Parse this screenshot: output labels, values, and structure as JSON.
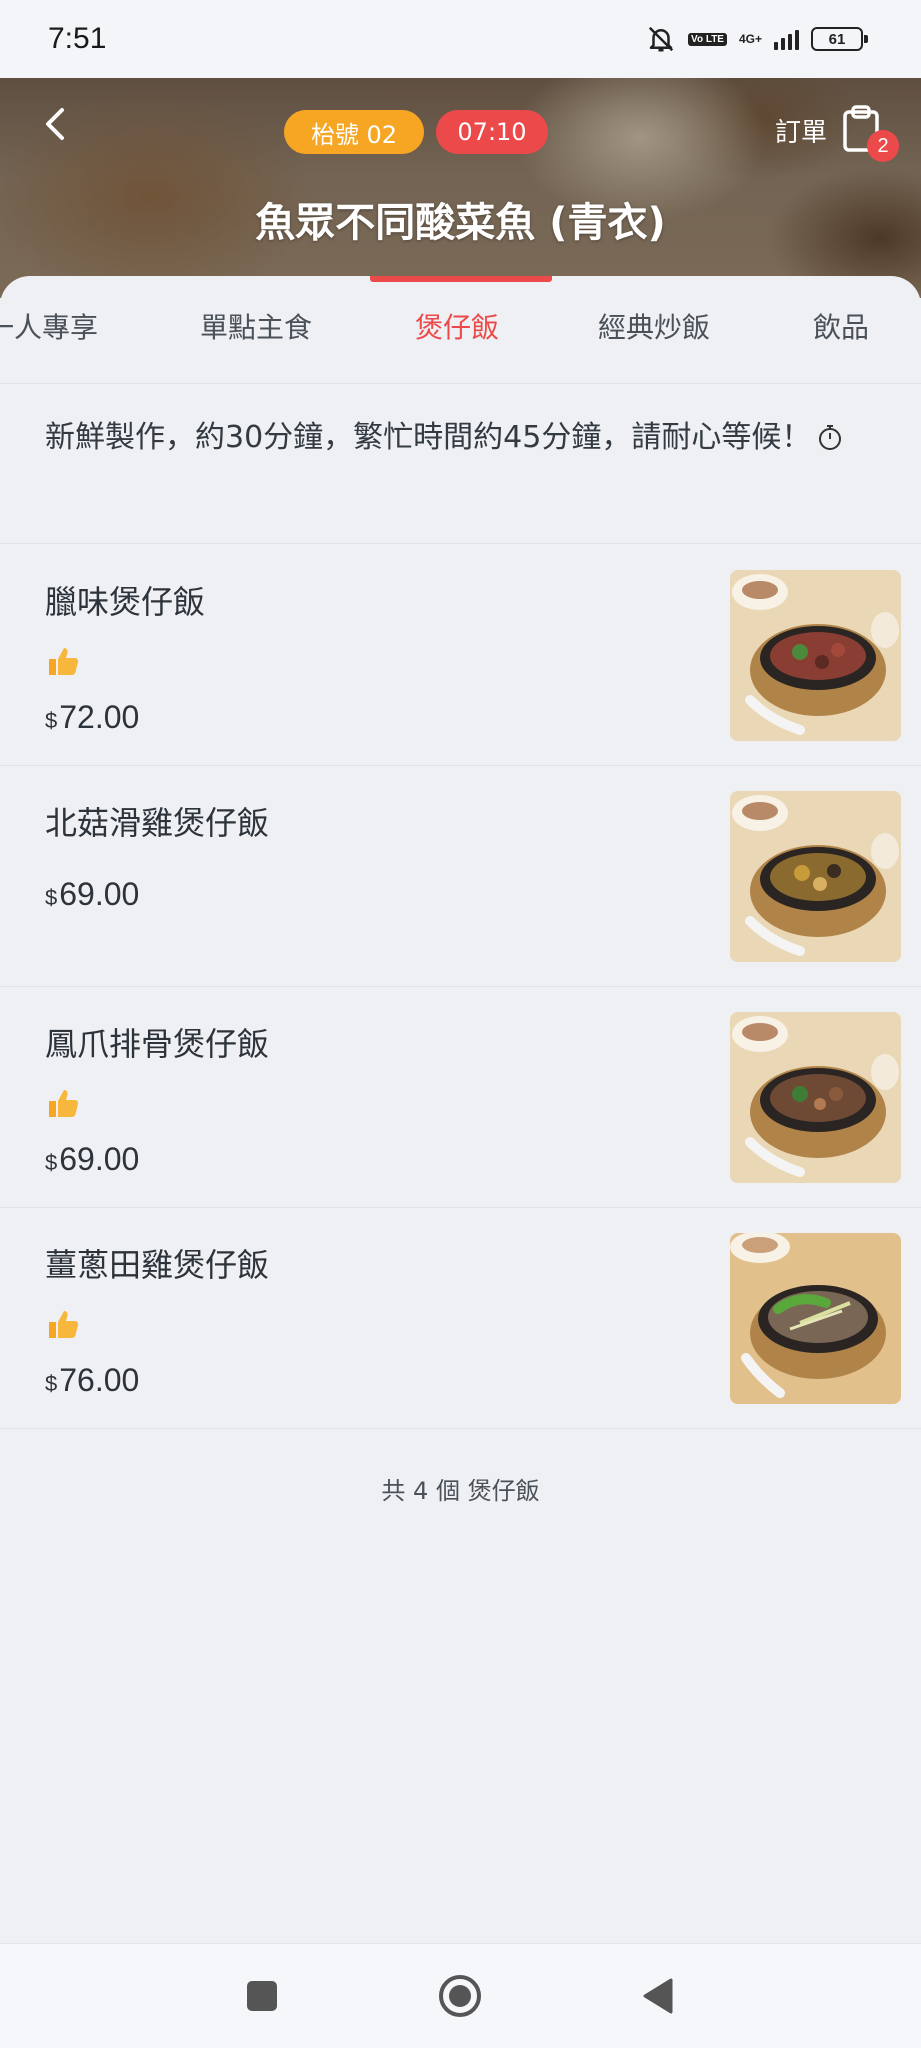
{
  "status_bar": {
    "time": "7:51",
    "volte": "Vo LTE",
    "network": "4G+",
    "battery": "61"
  },
  "header": {
    "table_label": "枱號 02",
    "timer": "07:10",
    "order_label": "訂單",
    "order_count": "2",
    "shop_name": "魚眾不同酸菜魚 (青衣)"
  },
  "tabs": [
    {
      "label": "一人專享",
      "active": false
    },
    {
      "label": "單點主食",
      "active": false
    },
    {
      "label": "煲仔飯",
      "active": true
    },
    {
      "label": "經典炒飯",
      "active": false
    },
    {
      "label": "飲品",
      "active": false
    }
  ],
  "notice": {
    "text": "新鮮製作，約30分鐘，繁忙時間約45分鐘，請耐心等候！"
  },
  "items": [
    {
      "name": "臘味煲仔飯",
      "recommended": true,
      "currency": "$",
      "price": "72.00"
    },
    {
      "name": "北菇滑雞煲仔飯",
      "recommended": false,
      "currency": "$",
      "price": "69.00"
    },
    {
      "name": "鳳爪排骨煲仔飯",
      "recommended": true,
      "currency": "$",
      "price": "69.00"
    },
    {
      "name": "薑蔥田雞煲仔飯",
      "recommended": true,
      "currency": "$",
      "price": "76.00"
    }
  ],
  "footer": {
    "summary": "共 4 個 煲仔飯"
  },
  "colors": {
    "accent": "#ec4a4a",
    "table_pill": "#f6a623",
    "background": "#eef0f3"
  }
}
